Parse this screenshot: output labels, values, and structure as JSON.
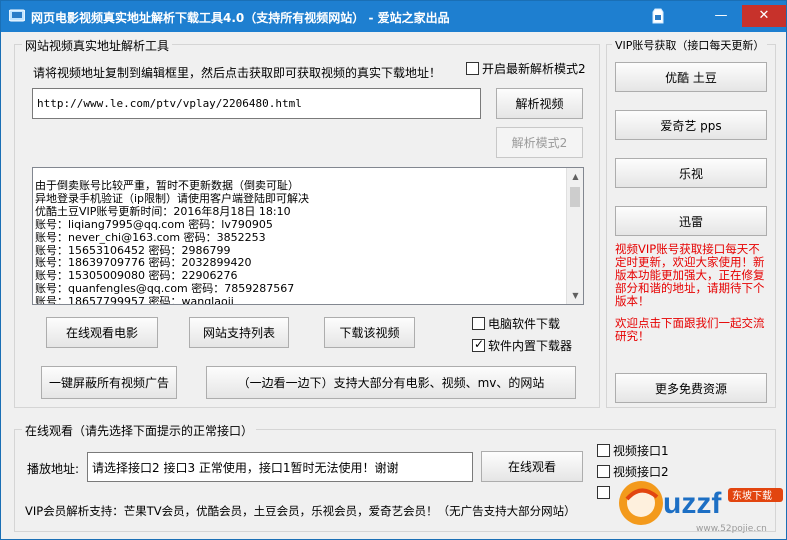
{
  "window": {
    "title": "网页电影视频真实地址解析下载工具4.0（支持所有视频网站） - 爱站之家出品",
    "min_label": "—",
    "close_label": "✕"
  },
  "parse_group": {
    "label": "网站视频真实地址解析工具",
    "instruction": "请将视频地址复制到编辑框里，然后点击获取即可获取视频的真实下载地址！",
    "latest_mode_checkbox": "开启最新解析模式2",
    "latest_mode_checked": false,
    "url_value": "http://www.le.com/ptv/vplay/2206480.html",
    "parse_button": "解析视频",
    "parse_mode2_button": "解析模式2",
    "result_lines": [
      "由于倒卖账号比较严重，暂时不更新数据（倒卖可耻）",
      "异地登录手机验证（ip限制）请使用客户端登陆即可解决",
      "优酷土豆VIP账号更新时间：2016年8月18日 18:10",
      "账号：liqiang7995@qq.com 密码：lv790905",
      "账号：never_chi@163.com 密码：3852253",
      "账号：15653106452 密码：2986799",
      "账号：18639709776 密码：2032899420",
      "账号：15305009080 密码：22906276",
      "账号：quanfengles@qq.com 密码：7859287567",
      "账号：18657799957 密码：wanglaoji"
    ],
    "watch_online_movie_button": "在线观看电影",
    "site_list_button": "网站支持列表",
    "download_video_button": "下载该视频",
    "pc_download_checkbox": "电脑软件下载",
    "pc_download_checked": false,
    "builtin_download_checkbox": "软件内置下载器",
    "builtin_download_checked": true,
    "block_ads_button": "一键屏蔽所有视频广告",
    "watch_and_download_button": "（一边看一边下）支持大部分有电影、视频、mv、的网站"
  },
  "vip_group": {
    "label": "VIP账号获取（接口每天更新）",
    "buttons": [
      "优酷 土豆",
      "爱奇艺 pps",
      "乐视",
      "迅雷"
    ],
    "notice": "视频VIP账号获取接口每天不定时更新，欢迎大家使用！新版本功能更加强大，正在修复部分和谐的地址，请期待下个版本！",
    "join_notice": "欢迎点击下面跟我们一起交流研究！",
    "more_resources_button": "更多免费资源"
  },
  "online_group": {
    "label": "在线观看（请先选择下面提示的正常接口）",
    "play_address_label": "播放地址:",
    "play_address_value": "请选择接口2 接口3 正常使用，接口1暂时无法使用！谢谢",
    "watch_button": "在线观看",
    "interface1_checkbox": "视频接口1",
    "interface2_checkbox": "视频接口2",
    "vip_support_text": "VIP会员解析支持：芒果TV会员，优酷会员，土豆会员，乐视会员，爱奇艺会员！（无广告支持大部分网站）"
  },
  "watermark": {
    "brand": "uzzf",
    "tag": "东坡下载",
    "url": "www.52pojie.cn"
  },
  "colors": {
    "titlebar": "#1e7fd0",
    "notice_red": "#e60000"
  }
}
